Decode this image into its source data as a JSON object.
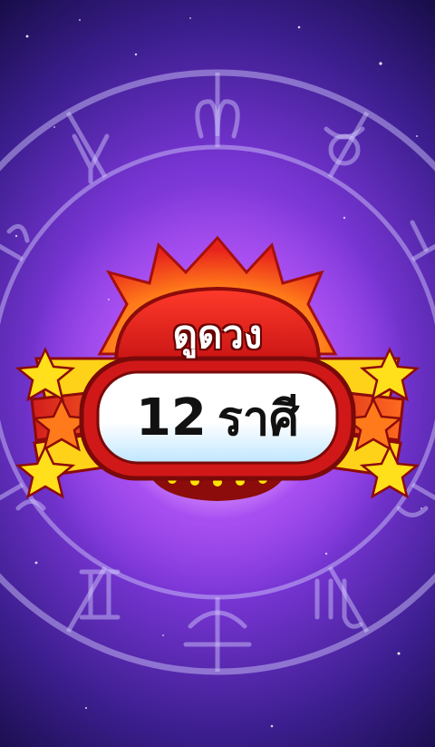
{
  "splash": {
    "title_line1": "ดูดวง",
    "title_line2_number": "12",
    "title_line2_text": "ราศี"
  },
  "colors": {
    "background_deep": "#160c45",
    "background_glow": "#b558f5",
    "sun_red": "#e52420",
    "sun_orange": "#f7931e",
    "star_yellow": "#ffe01a",
    "pill_white": "#ffffff",
    "pill_blue": "#bfe6ff",
    "text_black": "#111111",
    "dot_yellow": "#ffe600"
  },
  "icons": {
    "zodiac_wheel": "zodiac-wheel-icon",
    "sun_burst": "sun-burst-icon",
    "stars": "star-icon"
  }
}
